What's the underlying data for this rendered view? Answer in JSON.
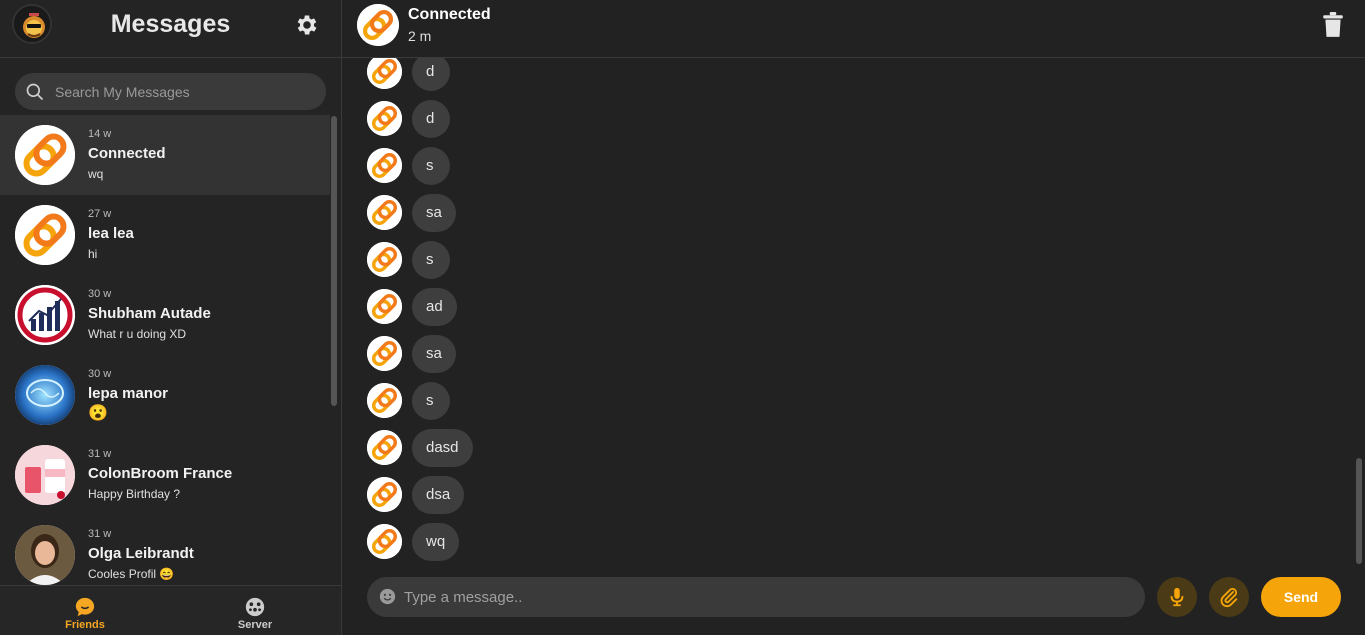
{
  "sidebar": {
    "title": "Messages",
    "search_placeholder": "Search My Messages",
    "conversations": [
      {
        "time": "14 w",
        "name": "Connected",
        "preview": "wq",
        "avatar": "connected-logo-icon",
        "active": true
      },
      {
        "time": "27 w",
        "name": "lea lea",
        "preview": "hi",
        "avatar": "connected-logo-icon"
      },
      {
        "time": "30 w",
        "name": "Shubham Autade",
        "preview": "What r u doing XD",
        "avatar": "chart-logo-icon"
      },
      {
        "time": "30 w",
        "name": "lepa manor",
        "preview": "😮",
        "avatar": "brain-photo-icon"
      },
      {
        "time": "31 w",
        "name": "ColonBroom France",
        "preview": "Happy Birthday ?",
        "avatar": "product-photo-icon"
      },
      {
        "time": "31 w",
        "name": "Olga Leibrandt",
        "preview": "Cooles Profil 😄",
        "avatar": "person-photo-icon"
      }
    ],
    "nav": {
      "friends": "Friends",
      "server": "Server"
    }
  },
  "chat": {
    "contact_name": "Connected",
    "contact_status": "2 m",
    "messages": [
      "d",
      "d",
      "s",
      "sa",
      "s",
      "ad",
      "sa",
      "s",
      "dasd",
      "dsa",
      "wq"
    ],
    "composer_placeholder": "Type a message..",
    "send_label": "Send"
  },
  "colors": {
    "accent": "#f5a50a",
    "background": "#222222",
    "sidebar": "#242424",
    "bubble": "#3e3e3e"
  }
}
